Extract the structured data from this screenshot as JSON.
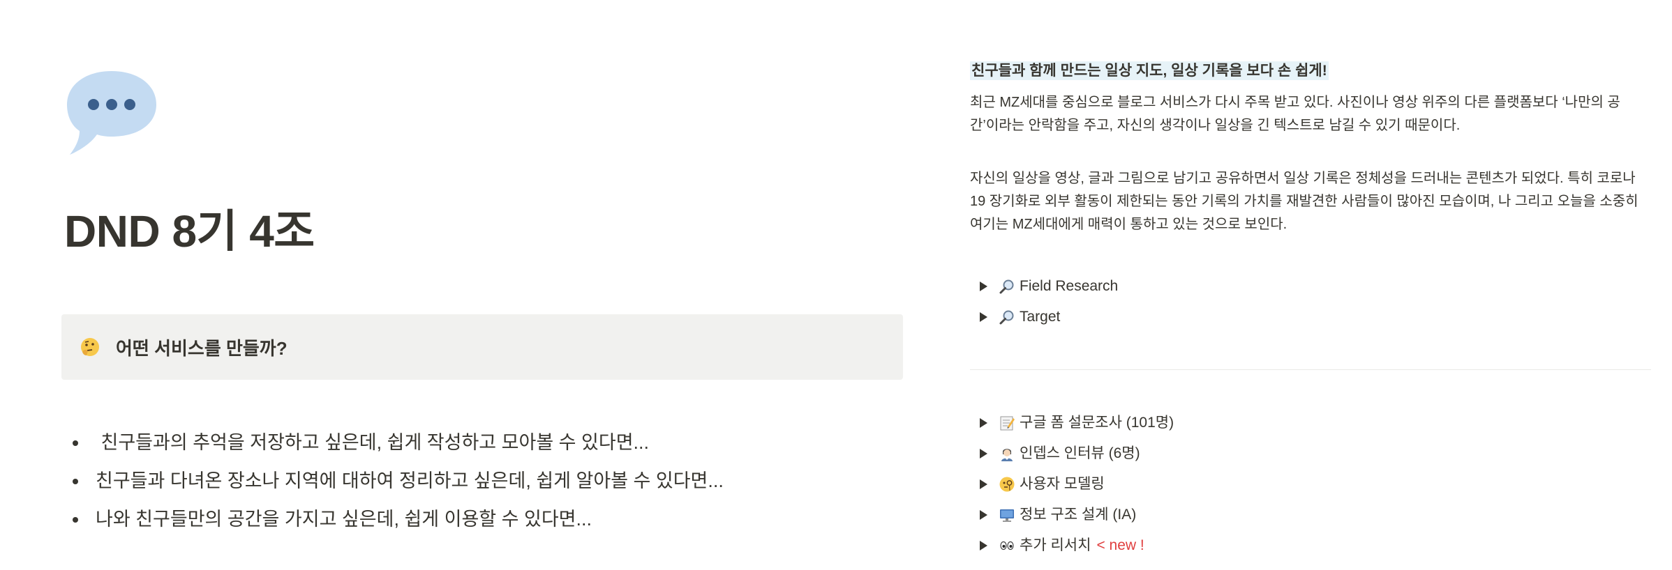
{
  "page": {
    "title": "DND 8기 4조",
    "icon": "speech-bubble-icon"
  },
  "callout": {
    "icon": "thinking-face-icon",
    "text": "어떤 서비스를 만들까?",
    "background": "#f1f1ef"
  },
  "bullets": [
    " 친구들과의 추억을 저장하고 싶은데, 쉽게 작성하고 모아볼 수 있다면...",
    "친구들과 다녀온 장소나 지역에 대하여 정리하고 싶은데, 쉽게 알아볼 수 있다면...",
    "나와 친구들만의 공간을 가지고 싶은데, 쉽게 이용할 수 있다면..."
  ],
  "right": {
    "heading": "친구들과 함께 만드는 일상 지도, 일상 기록을 보다 손 쉽게!",
    "paragraph1": "최근 MZ세대를 중심으로 블로그 서비스가 다시 주목 받고 있다. 사진이나 영상 위주의 다른 플랫폼보다 ‘나만의 공간’이라는 안락함을 주고, 자신의 생각이나 일상을 긴 텍스트로 남길 수 있기 때문이다.",
    "paragraph2": "자신의 일상을 영상, 글과 그림으로 남기고 공유하면서 일상 기록은 정체성을 드러내는 콘텐츠가 되었다. 특히 코로나19 장기화로 외부 활동이 제한되는 동안 기록의 가치를 재발견한 사람들이 많아진 모습이며, 나 그리고 오늘을 소중히 여기는 MZ세대에게 매력이 통하고 있는 것으로 보인다.",
    "toggles_top": [
      {
        "icon": "magnifier-icon",
        "label": "Field Research"
      },
      {
        "icon": "magnifier-icon",
        "label": "Target"
      }
    ],
    "toggles_bottom": [
      {
        "icon": "memo-icon",
        "label": "구글 폼 설문조사 (101명)"
      },
      {
        "icon": "person-icon",
        "label": "인뎁스 인터뷰 (6명)"
      },
      {
        "icon": "face-monocle-icon",
        "label": "사용자 모델링"
      },
      {
        "icon": "computer-icon",
        "label": "정보 구조 설계 (IA)"
      },
      {
        "icon": "eyes-icon",
        "label": "추가 리서치",
        "badge": "< new !"
      }
    ]
  },
  "colors": {
    "text": "#37352f",
    "highlight": "#e7f3f8",
    "new_badge": "#e03e3e"
  }
}
